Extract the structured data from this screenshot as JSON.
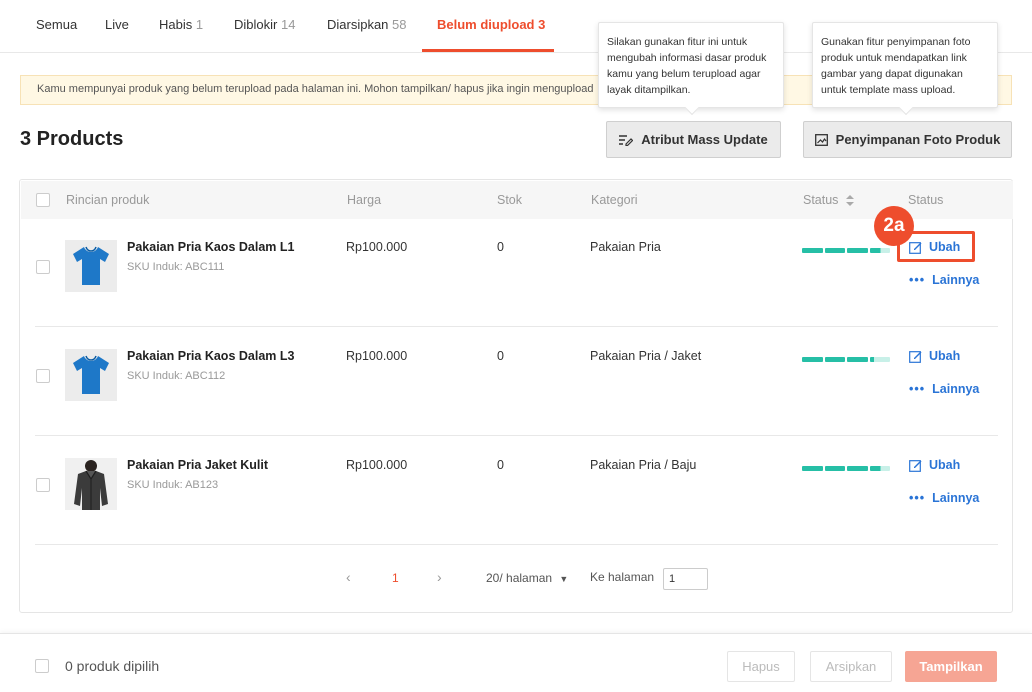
{
  "tabs": [
    {
      "label": "Semua",
      "count": ""
    },
    {
      "label": "Live",
      "count": ""
    },
    {
      "label": "Habis",
      "count": "1"
    },
    {
      "label": "Diblokir",
      "count": "14"
    },
    {
      "label": "Diarsipkan",
      "count": "58"
    },
    {
      "label": "Belum diupload",
      "count": "3"
    }
  ],
  "notice": "Kamu mempunyai produk yang belum terupload pada halaman ini. Mohon tampilkan/ hapus jika ingin mengupload",
  "tooltips": {
    "mass_update": "Silakan gunakan fitur ini untuk mengubah informasi dasar produk kamu yang belum terupload agar layak ditampilkan.",
    "photo_storage": "Gunakan fitur penyimpanan foto produk untuk mendapatkan link gambar yang dapat digunakan untuk template mass upload."
  },
  "products_count": "3 Products",
  "buttons": {
    "mass_update": "Atribut Mass Update",
    "photo_storage": "Penyimpanan Foto Produk"
  },
  "table": {
    "headers": {
      "details": "Rincian produk",
      "price": "Harga",
      "stock": "Stok",
      "category": "Kategori",
      "status": "Status",
      "action": "Status"
    },
    "rows": [
      {
        "name": "Pakaian Pria Kaos Dalam L1",
        "sku": "SKU Induk: ABC111",
        "price": "Rp100.000",
        "stock": "0",
        "category": "Pakaian Pria",
        "image": "blue-tshirt",
        "completeness": 0.88
      },
      {
        "name": "Pakaian Pria Kaos Dalam L3",
        "sku": "SKU Induk: ABC112",
        "price": "Rp100.000",
        "stock": "0",
        "category": "Pakaian Pria / Jaket",
        "image": "blue-tshirt",
        "completeness": 0.8
      },
      {
        "name": "Pakaian Pria Jaket Kulit",
        "sku": "SKU Induk: AB123",
        "price": "Rp100.000",
        "stock": "0",
        "category": "Pakaian Pria / Baju",
        "image": "leather-jacket",
        "completeness": 0.88
      }
    ],
    "edit_label": "Ubah",
    "more_label": "Lainnya"
  },
  "annotation_badge": "2a",
  "pagination": {
    "current_page": "1",
    "page_size": "20/ halaman",
    "goto_label": "Ke halaman",
    "goto_value": "1"
  },
  "footer": {
    "selected": "0 produk dipilih",
    "delete": "Hapus",
    "archive": "Arsipkan",
    "show": "Tampilkan"
  },
  "colors": {
    "accent": "#ee4d2d",
    "link": "#2a74d6",
    "progress": "#26bfa6",
    "progress_empty": "#c8f0e8"
  }
}
